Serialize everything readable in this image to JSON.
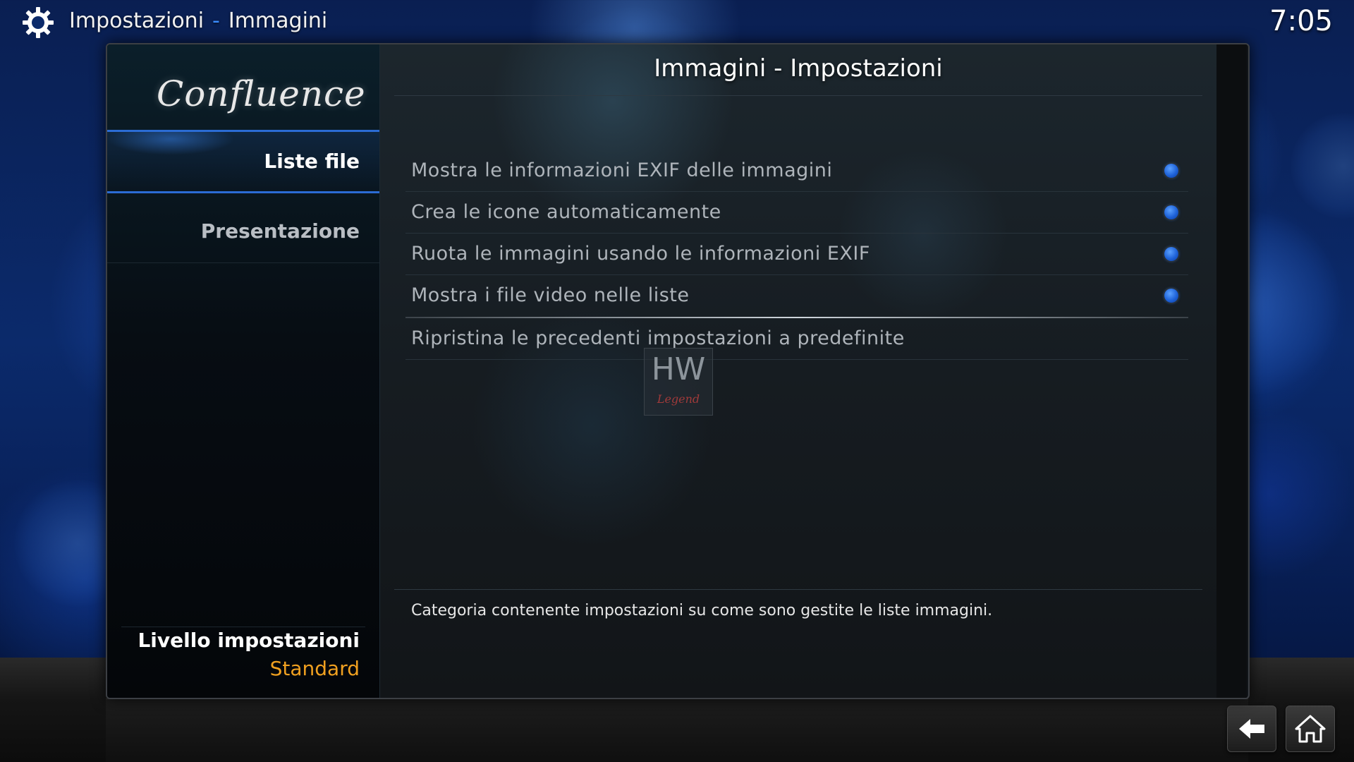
{
  "header": {
    "section": "Impostazioni",
    "separator": "-",
    "page": "Immagini",
    "clock": "7:05"
  },
  "sidebar": {
    "logo_text": "Confluence",
    "items": [
      {
        "label": "Liste file",
        "active": true
      },
      {
        "label": "Presentazione",
        "active": false
      }
    ],
    "level_label": "Livello impostazioni",
    "level_value": "Standard"
  },
  "dialog": {
    "title": "Immagini - Impostazioni",
    "close_label": "✕",
    "settings": [
      {
        "label": "Mostra le informazioni EXIF delle immagini",
        "enabled": true
      },
      {
        "label": "Crea le icone automaticamente",
        "enabled": true
      },
      {
        "label": "Ruota le immagini usando le informazioni EXIF",
        "enabled": true
      },
      {
        "label": "Mostra i file video nelle liste",
        "enabled": true
      }
    ],
    "reset_label": "Ripristina le precedenti impostazioni a predefinite",
    "watermark_text": "HW",
    "watermark_sub": "Legend",
    "description": "Categoria contenente impostazioni su come sono gestite le liste immagini."
  },
  "colors": {
    "accent": "#2b6cd4",
    "level_value": "#f0a020",
    "toggle_on": "#1e62d8"
  },
  "icons": {
    "settings": "gear-icon",
    "back": "back-arrow-icon",
    "home": "home-icon",
    "close": "close-icon"
  }
}
